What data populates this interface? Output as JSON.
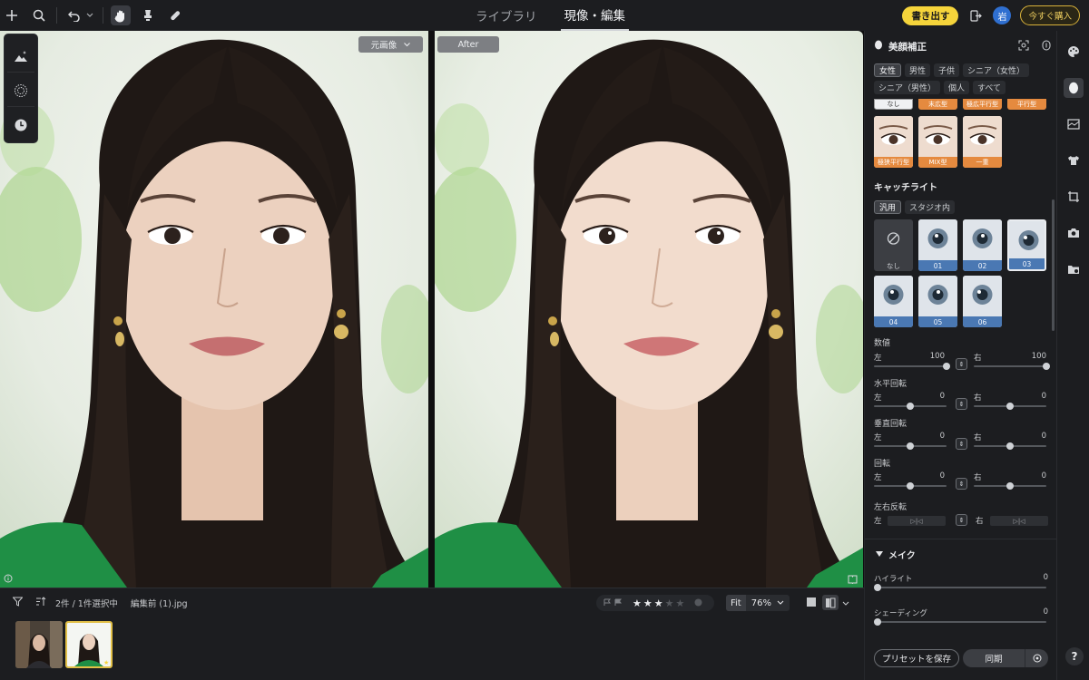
{
  "topbar": {
    "tabs": [
      {
        "label": "ライブラリ",
        "active": false
      },
      {
        "label": "現像・編集",
        "active": true
      }
    ],
    "export_label": "書き出す",
    "avatar_initial": "岩",
    "buy_label": "今すぐ購入"
  },
  "canvas": {
    "before_label": "元画像",
    "after_label": "After"
  },
  "filmstrip": {
    "selection_text": "2件 / 1件選択中",
    "filename": "編集前 (1).jpg",
    "rating": 3,
    "rating_max": 5,
    "zoom_fit_label": "Fit",
    "zoom_value": "76%"
  },
  "panel": {
    "title": "美顔補正",
    "gender_chips": [
      "女性",
      "男性",
      "子供",
      "シニア（女性）"
    ],
    "gender_chips2": [
      "シニア（男性）",
      "個人",
      "すべて"
    ],
    "eye_shapes_top": [
      "なし",
      "末広型",
      "極広平行型",
      "平行型"
    ],
    "eye_shapes": [
      "極狭平行型",
      "MIX型",
      "一重"
    ],
    "catchlight_title": "キャッチライト",
    "catchlight_tabs": [
      "汎用",
      "スタジオ内"
    ],
    "catchlights": [
      "なし",
      "01",
      "02",
      "03",
      "04",
      "05",
      "06"
    ],
    "selected_catchlight": "03",
    "sliders": {
      "value_title": "数値",
      "value_left_label": "左",
      "value_left": "100",
      "value_right_label": "右",
      "value_right": "100",
      "hrot_title": "水平回転",
      "hrot_left": "0",
      "hrot_right": "0",
      "vrot_title": "垂直回転",
      "vrot_left": "0",
      "vrot_right": "0",
      "rot_title": "回転",
      "rot_left": "0",
      "rot_right": "0",
      "flip_title": "左右反転",
      "left_label": "左",
      "right_label": "右"
    },
    "make_title": "メイク",
    "highlight_label": "ハイライト",
    "highlight_value": "0",
    "shading_label": "シェーディング",
    "shading_value": "0",
    "save_preset_label": "プリセットを保存",
    "sync_label": "同期"
  },
  "colors": {
    "accent_yellow": "#f5d43b",
    "eye_card_orange": "#e58a3f",
    "catchlight_blue": "#4a78b3"
  }
}
